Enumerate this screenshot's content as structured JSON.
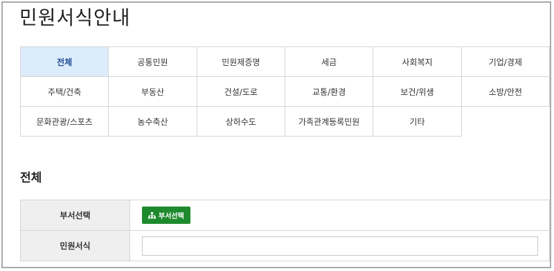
{
  "page": {
    "title": "민원서식안내"
  },
  "categories": {
    "rows": [
      [
        "전체",
        "공통민원",
        "민원제증명",
        "세금",
        "사회복지",
        "기업/경제"
      ],
      [
        "주택/건축",
        "부동산",
        "건설/도로",
        "교통/환경",
        "보건/위생",
        "소방/안전"
      ],
      [
        "문화관광/스포츠",
        "농수축산",
        "상하수도",
        "가족관계등록민원",
        "기타"
      ]
    ],
    "active": "전체"
  },
  "section": {
    "title": "전체"
  },
  "form": {
    "dept_label": "부서선택",
    "dept_button": "부서선택",
    "dept_button_icon": "org-chart-icon",
    "form_label": "민원서식",
    "form_value": "",
    "button_color": "#1e8a2e",
    "active_color": "#dcecfb"
  }
}
